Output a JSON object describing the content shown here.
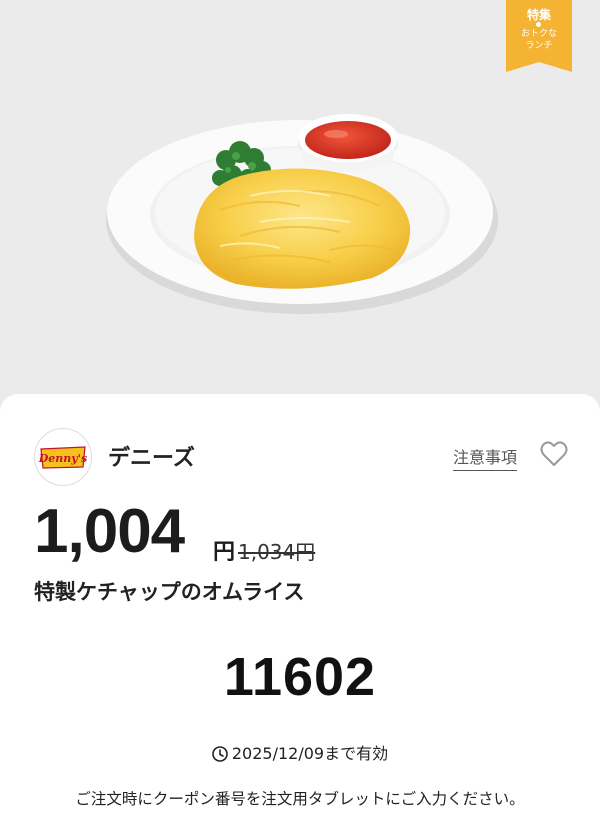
{
  "hero": {
    "ribbon_line1": "特集",
    "ribbon_line2": "おトクな",
    "ribbon_line3": "ランチ",
    "ribbon_color": "#f5b334"
  },
  "store": {
    "name": "デニーズ",
    "logo_text": "Denny's",
    "logo_colors": {
      "badge": "#f3c21b",
      "text": "#c8102e"
    }
  },
  "actions": {
    "notice_label": "注意事項",
    "favorite_icon": "heart-outline-icon"
  },
  "pricing": {
    "price": "1,004",
    "currency": "円",
    "original_price": "1,034円"
  },
  "product": {
    "name": "特製ケチャップのオムライス"
  },
  "coupon": {
    "code": "11602",
    "validity": "2025/12/09まで有効",
    "validity_icon": "clock-icon",
    "instruction": "ご注文時にクーポン番号を注文用タブレットにご入力ください。"
  }
}
